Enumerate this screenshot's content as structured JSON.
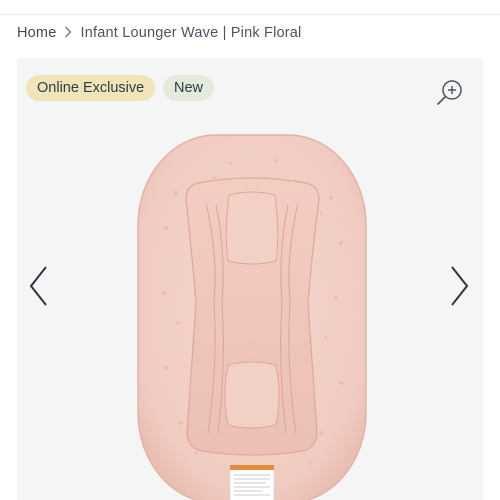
{
  "breadcrumb": {
    "home_label": "Home",
    "separator_icon": "chevron-right-icon",
    "current_label": "Infant Lounger Wave | Pink Floral"
  },
  "gallery": {
    "badges": {
      "online_exclusive": "Online Exclusive",
      "new": "New"
    },
    "zoom_icon": "zoom-in-icon",
    "prev_icon": "chevron-left-icon",
    "next_icon": "chevron-right-icon",
    "product_image": "pink-floral-infant-lounger",
    "colors": {
      "background": "#f5f5f5",
      "lounger_pink": "#f2cfc6",
      "badge_online": "#efe5b8",
      "badge_new": "#e3ebdd",
      "text": "#3f4a56"
    }
  }
}
